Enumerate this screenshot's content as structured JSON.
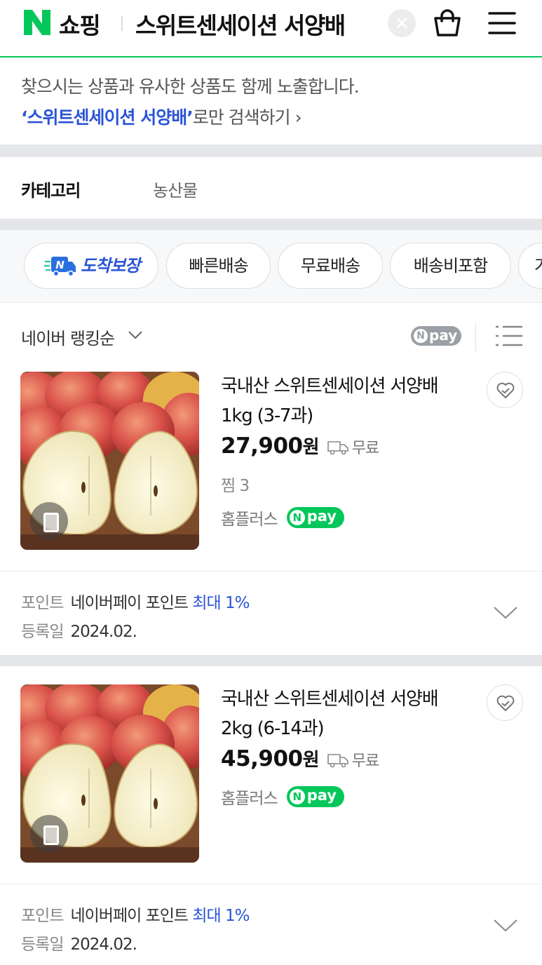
{
  "header": {
    "logo_letter": "N",
    "logo_text": "쇼핑",
    "search_query": "스위트센세이션 서양배",
    "colors": {
      "brand": "#03c75a"
    }
  },
  "notice": {
    "line1": "찾으시는 상품과 유사한 상품도 함께 노출합니다.",
    "quoted_query": "‘스위트센세이션 서양배’",
    "suffix": "로만 검색하기 ›"
  },
  "category": {
    "label": "카테고리",
    "value": "농산물"
  },
  "filters": {
    "chips": [
      "도착보장",
      "빠른배송",
      "무료배송",
      "배송비포함",
      "가"
    ]
  },
  "sort": {
    "label": "네이버 랭킹순",
    "npay_filter_label": "pay",
    "npay_filter_icon": "N"
  },
  "products": [
    {
      "title": "국내산 스위트센세이션 서양배 1kg (3-7과)",
      "price": "27,900",
      "won": "원",
      "shipping": "무료",
      "wishlist": "찜 3",
      "seller": "홈플러스",
      "npay": "pay",
      "npay_icon": "N",
      "points_key": "포인트",
      "points_val": "네이버페이 포인트",
      "points_highlight": "최대 1%",
      "reg_key": "등록일",
      "reg_val": "2024.02."
    },
    {
      "title": "국내산 스위트센세이션 서양배 2kg (6-14과)",
      "price": "45,900",
      "won": "원",
      "shipping": "무료",
      "seller": "홈플러스",
      "npay": "pay",
      "npay_icon": "N",
      "points_key": "포인트",
      "points_val": "네이버페이 포인트",
      "points_highlight": "최대 1%",
      "reg_key": "등록일",
      "reg_val": "2024.02."
    }
  ]
}
